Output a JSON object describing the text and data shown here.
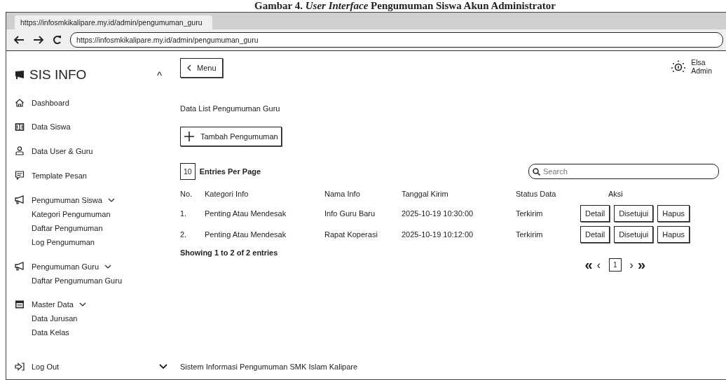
{
  "caption": "Gambar 4. *User Interface* Pengumuman Siswa Akun Administrator",
  "browser": {
    "tab_title": "https://infosmkikalipare.my.id/admin/pengumuman_guru",
    "address": "https://infosmkikalipare.my.id/admin/pengumuman_guru"
  },
  "sidebar": {
    "brand": "SIS INFO",
    "collapse": "^",
    "items": [
      {
        "kind": "link",
        "label": "Dashboard"
      },
      {
        "kind": "link",
        "label": "Data Siswa"
      },
      {
        "kind": "link",
        "label": "Data User & Guru"
      },
      {
        "kind": "link",
        "label": "Template Pesan"
      },
      {
        "kind": "group",
        "label": "Pengumuman Siswa",
        "children": [
          {
            "label": "Kategori Pengumuman"
          },
          {
            "label": "Daftar Pengumuman"
          },
          {
            "label": "Log Pengumuman"
          }
        ]
      },
      {
        "kind": "group",
        "label": "Pengumuman Guru",
        "children": [
          {
            "label": "Daftar Pengumuman Guru"
          }
        ]
      },
      {
        "kind": "group",
        "label": "Master Data",
        "children": [
          {
            "label": "Data Jurusan"
          },
          {
            "label": "Data Kelas"
          }
        ]
      }
    ],
    "logout": "Log Out"
  },
  "header": {
    "menu_button": "Menu",
    "user_name": "Elsa",
    "user_role": "Admin"
  },
  "page_title": "Data List Pengumuman Guru",
  "add_button": "Tambah Pengumuman",
  "entries": {
    "value": "10",
    "label": "Entries Per Page"
  },
  "search": {
    "placeholder": "Search"
  },
  "table": {
    "columns": [
      "No.",
      "Kategori Info",
      "Nama Info",
      "Tanggal Kirim",
      "Status Data",
      "Aksi"
    ],
    "rows": [
      {
        "no": "1.",
        "kategori": "Penting Atau Mendesak",
        "nama": "Info Guru Baru",
        "tanggal": "2025-10-19 10:30:00",
        "status": "Terkirim",
        "actions": [
          "Detail",
          "Disetujui",
          "Hapus"
        ]
      },
      {
        "no": "2.",
        "kategori": "Penting Atau Mendesak",
        "nama": "Rapat Koperasi",
        "tanggal": "2025-10-19 10:12:00",
        "status": "Terkirim",
        "actions": [
          "Detail",
          "Disetujui",
          "Hapus"
        ]
      }
    ]
  },
  "summary": "Showing 1 to 2 of 2 entries",
  "pagination": {
    "first": "«",
    "prev": "‹",
    "pages": [
      {
        "label": "1",
        "selected": true
      }
    ],
    "next": "›",
    "last": "»"
  },
  "footer": "Sistem Informasi Pengumuman SMK Islam Kalipare"
}
